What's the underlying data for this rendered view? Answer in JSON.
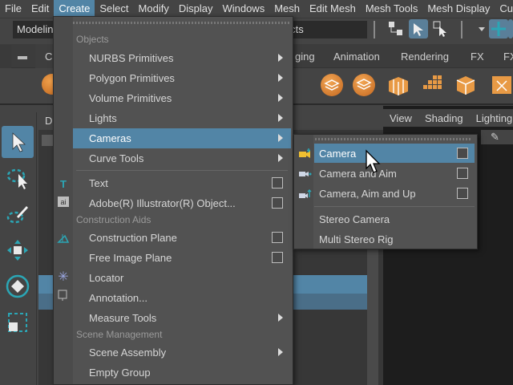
{
  "menubar": {
    "items": [
      "File",
      "Edit",
      "Create",
      "Select",
      "Modify",
      "Display",
      "Windows",
      "Mesh",
      "Edit Mesh",
      "Mesh Tools",
      "Mesh Display",
      "Cu"
    ]
  },
  "statusline": {
    "mode": "Modeling",
    "objects_field": "jects"
  },
  "shelf": {
    "tabs": [
      "C",
      "ging",
      "Animation",
      "Rendering",
      "FX",
      "FX"
    ]
  },
  "panel": {
    "title": "D",
    "viewport_menu": [
      "View",
      "Shading",
      "Lighting"
    ]
  },
  "create_menu": {
    "sections": {
      "objects": "Objects",
      "construction_aids": "Construction Aids",
      "scene_management": "Scene Management"
    },
    "items": {
      "nurbs": "NURBS Primitives",
      "polygon": "Polygon Primitives",
      "volume": "Volume Primitives",
      "lights": "Lights",
      "cameras": "Cameras",
      "curve_tools": "Curve Tools",
      "text": "Text",
      "illustrator": "Adobe(R) Illustrator(R) Object...",
      "construction_plane": "Construction Plane",
      "free_image_plane": "Free Image Plane",
      "locator": "Locator",
      "annotation": "Annotation...",
      "measure_tools": "Measure Tools",
      "scene_assembly": "Scene Assembly",
      "empty_group": "Empty Group"
    }
  },
  "cameras_menu": {
    "camera": "Camera",
    "camera_and_aim": "Camera and Aim",
    "camera_aim_up": "Camera, Aim and Up",
    "stereo_camera": "Stereo Camera",
    "multi_stereo_rig": "Multi Stereo Rig"
  },
  "colors": {
    "highlight": "#5285a6",
    "menu_bg": "#525252",
    "accent_cyan": "#2ba6b5"
  }
}
